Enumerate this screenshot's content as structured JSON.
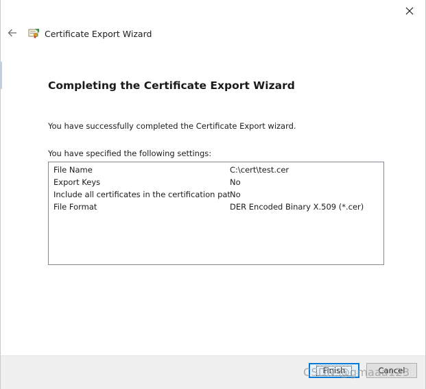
{
  "window": {
    "title": "Certificate Export Wizard"
  },
  "icons": {
    "back": "back-arrow-icon",
    "close": "close-icon",
    "title": "certificate-icon"
  },
  "page": {
    "heading": "Completing the Certificate Export Wizard",
    "success_message": "You have successfully completed the Certificate Export wizard.",
    "settings_label": "You have specified the following settings:"
  },
  "settings": [
    {
      "key": "File Name",
      "value": "C:\\cert\\test.cer"
    },
    {
      "key": "Export Keys",
      "value": "No"
    },
    {
      "key": "Include all certificates in the certification path",
      "value": "No"
    },
    {
      "key": "File Format",
      "value": "DER Encoded Binary X.509 (*.cer)"
    }
  ],
  "buttons": {
    "finish": "Finish",
    "cancel": "Cancel"
  },
  "watermark": "CSDN @gmaaa123",
  "colors": {
    "accent": "#0078d7",
    "footer_bg": "#f0f0f0",
    "list_border": "#828790"
  }
}
